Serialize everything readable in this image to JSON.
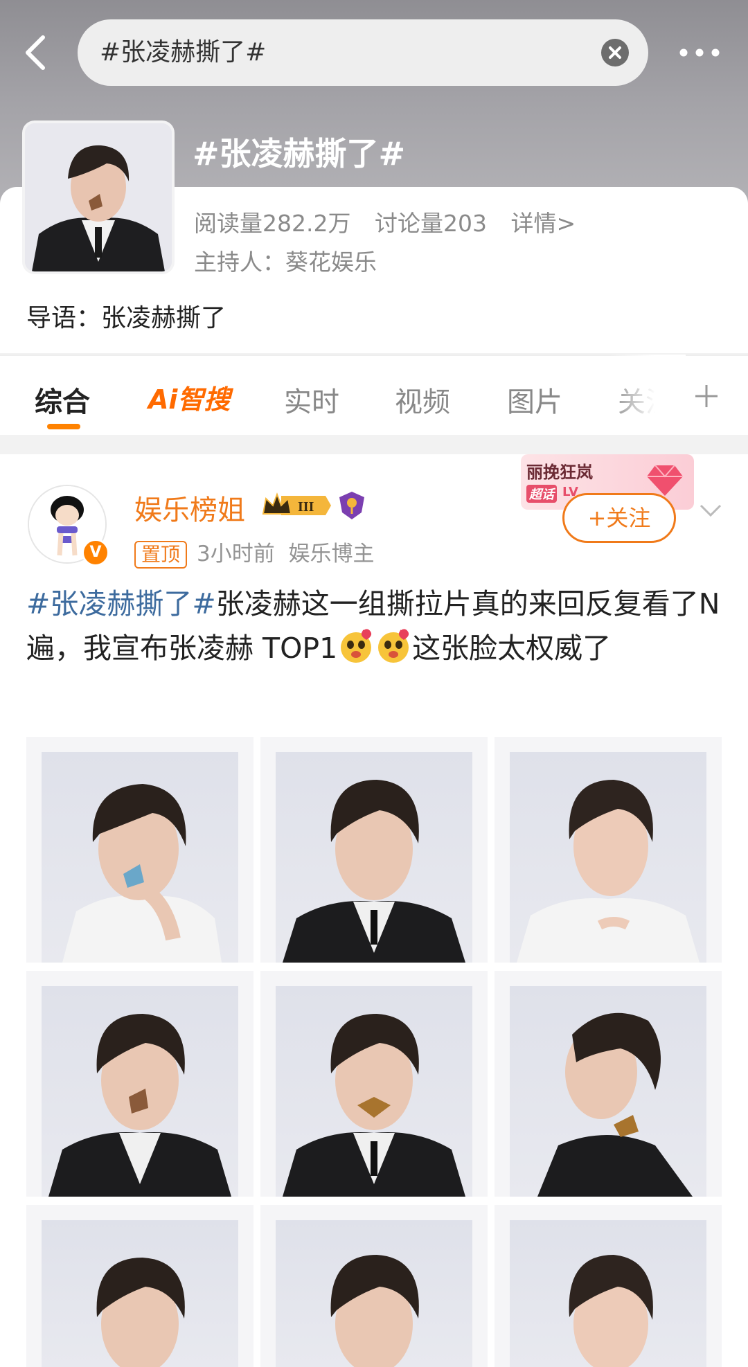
{
  "search": {
    "query": "#张凌赫撕了#"
  },
  "topic": {
    "title": "#张凌赫撕了#",
    "reads": "阅读量282.2万",
    "discussions": "讨论量203",
    "details": "详情>",
    "host": "主持人：葵花娱乐",
    "intro": "导语：张凌赫撕了"
  },
  "tabs": [
    {
      "label": "综合",
      "active": true
    },
    {
      "label": "Ai智搜"
    },
    {
      "label": "实时"
    },
    {
      "label": "视频"
    },
    {
      "label": "图片"
    },
    {
      "label": "关注"
    }
  ],
  "post": {
    "username": "娱乐榜姐",
    "level": "III",
    "pin": "置顶",
    "time": "3小时前",
    "role": "娱乐博主",
    "follow": "+关注",
    "promo_title": "丽挽狂岚",
    "promo_sub": "超话",
    "promo_level": "LV",
    "v_badge": "V",
    "text_tag": "#张凌赫撕了#",
    "text_a": "张凌赫这一组撕拉片真的来回反复看了N遍，我宣布张凌赫 TOP1",
    "text_b": "这张脸太权威了"
  },
  "colors": {
    "accent": "#ff8200",
    "link": "#3d6b9e",
    "username": "#f07a1a"
  }
}
